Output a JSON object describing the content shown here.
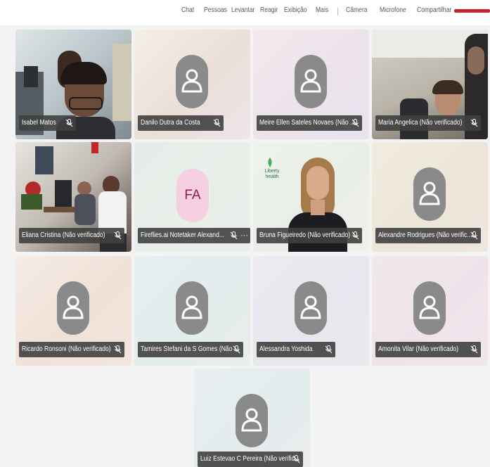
{
  "toolbar": {
    "items": [
      "Chat",
      "Pessoas",
      "Levantar",
      "Reagir",
      "Exibição",
      "Mais",
      "Câmera",
      "Microfone",
      "Compartilhar"
    ]
  },
  "participants": [
    {
      "name": "Isabel Matos",
      "type": "video",
      "muted": true
    },
    {
      "name": "Danilo Dutra da Costa",
      "type": "avatar",
      "muted": true
    },
    {
      "name": "Meire Ellen Sateles Novaes (Não ...",
      "type": "avatar",
      "muted": true
    },
    {
      "name": "Maria Angelica (Não verificado)",
      "type": "video",
      "muted": true
    },
    {
      "name": "Eliana Cristina (Não verificado)",
      "type": "video",
      "muted": true
    },
    {
      "name": "Fireflies.ai Notetaker Alexand...",
      "type": "initials",
      "initials": "FA",
      "muted": true
    },
    {
      "name": "Bruna Figueiredo (Não verificado)",
      "type": "video",
      "muted": true,
      "logo_text": "Liberty health"
    },
    {
      "name": "Alexandre Rodrigues (Não verific...",
      "type": "avatar",
      "muted": true
    },
    {
      "name": "Ricardo Ronsoni (Não verificado)",
      "type": "avatar",
      "muted": true
    },
    {
      "name": "Tamires Stefani da S Gomes (Não ...",
      "type": "avatar",
      "muted": true
    },
    {
      "name": "Alessandra Yoshida",
      "type": "avatar",
      "muted": true
    },
    {
      "name": "Amonita Vilar (Não verificado)",
      "type": "avatar",
      "muted": true
    },
    {
      "name": "Luiz Estevao C Pereira (Não verific...",
      "type": "avatar",
      "muted": true
    }
  ],
  "more_options": "···",
  "colors": {
    "leave_button": "#c4262e",
    "name_tag_bg": "#404040",
    "avatar_bg": "#8a8a8a"
  }
}
